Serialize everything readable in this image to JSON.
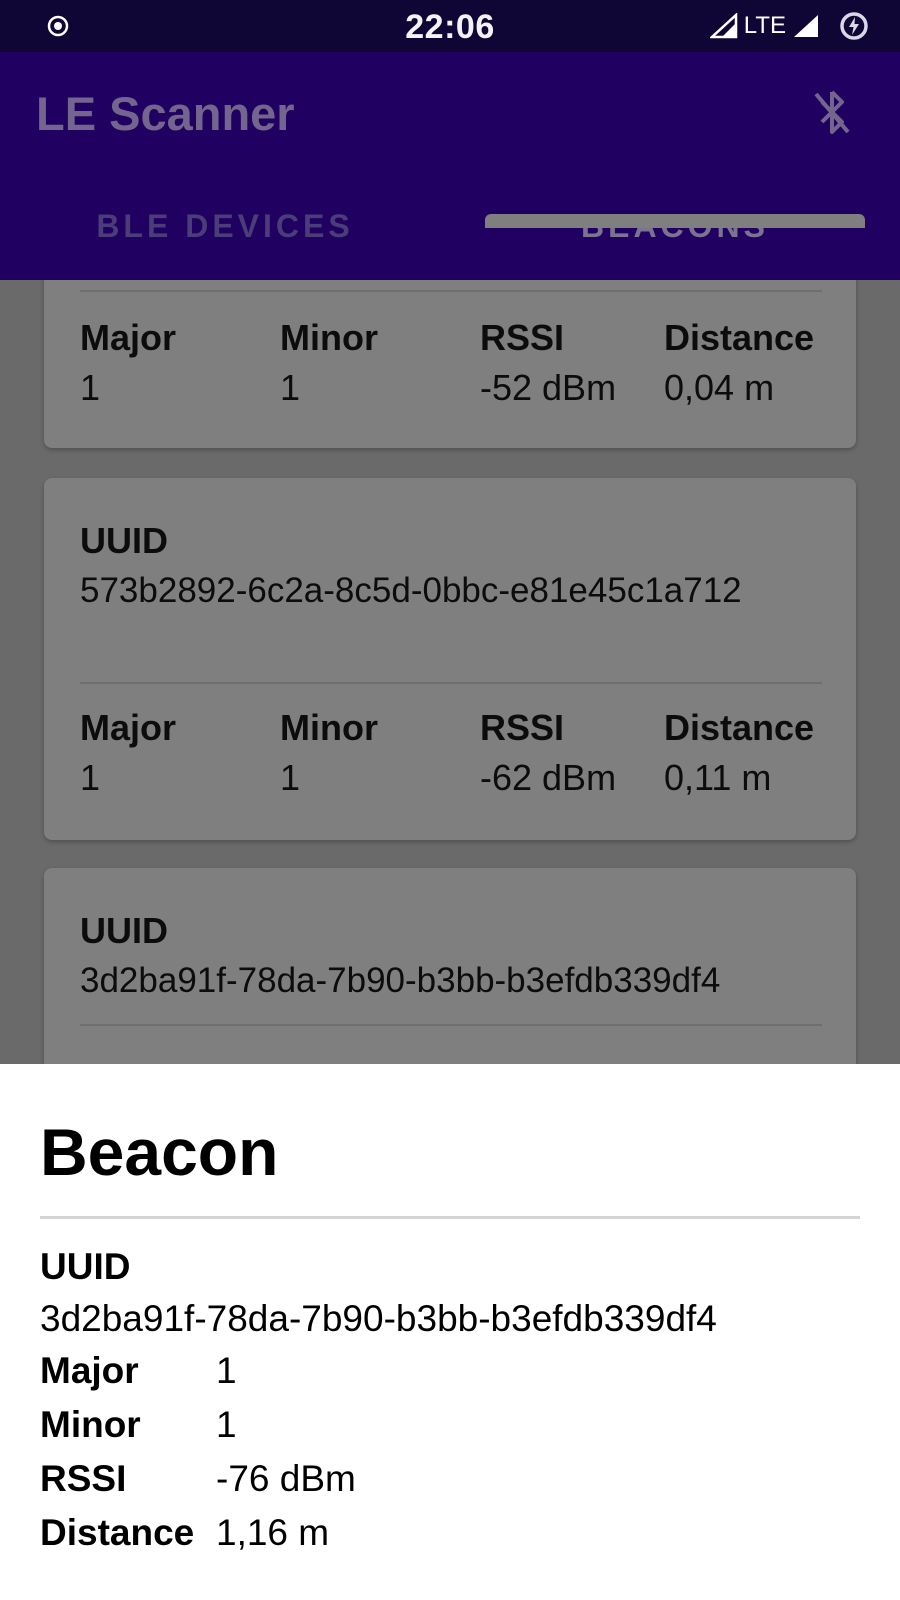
{
  "status_bar": {
    "time": "22:06",
    "network": "LTE",
    "left_icon": "record-icon",
    "right_icons": [
      "signal-icon",
      "signal-full-icon",
      "battery-charging-icon"
    ]
  },
  "app_bar": {
    "title": "LE Scanner",
    "action_icon": "bluetooth-disabled-icon",
    "tabs": [
      {
        "label": "BLE DEVICES",
        "selected": false
      },
      {
        "label": "BEACONS",
        "selected": true
      }
    ]
  },
  "labels": {
    "uuid": "UUID",
    "major": "Major",
    "minor": "Minor",
    "rssi": "RSSI",
    "distance": "Distance"
  },
  "beacons": [
    {
      "uuid": "",
      "major": "1",
      "minor": "1",
      "rssi": "-52 dBm",
      "distance": "0,04 m"
    },
    {
      "uuid": "573b2892-6c2a-8c5d-0bbc-e81e45c1a712",
      "major": "1",
      "minor": "1",
      "rssi": "-62 dBm",
      "distance": "0,11 m"
    },
    {
      "uuid": "3d2ba91f-78da-7b90-b3bb-b3efdb339df4"
    }
  ],
  "sheet": {
    "title": "Beacon",
    "uuid_label": "UUID",
    "uuid": "3d2ba91f-78da-7b90-b3bb-b3efdb339df4",
    "rows": [
      {
        "label": "Major",
        "value": "1"
      },
      {
        "label": "Minor",
        "value": "1"
      },
      {
        "label": "RSSI",
        "value": "-76 dBm"
      },
      {
        "label": "Distance",
        "value": "1,16 m"
      }
    ]
  },
  "colors": {
    "status_bar": "#0f0636",
    "app_bar": "#200060",
    "scrim_background": "#6a6a6a",
    "card": "#7f7f7f",
    "sheet": "#ffffff"
  }
}
